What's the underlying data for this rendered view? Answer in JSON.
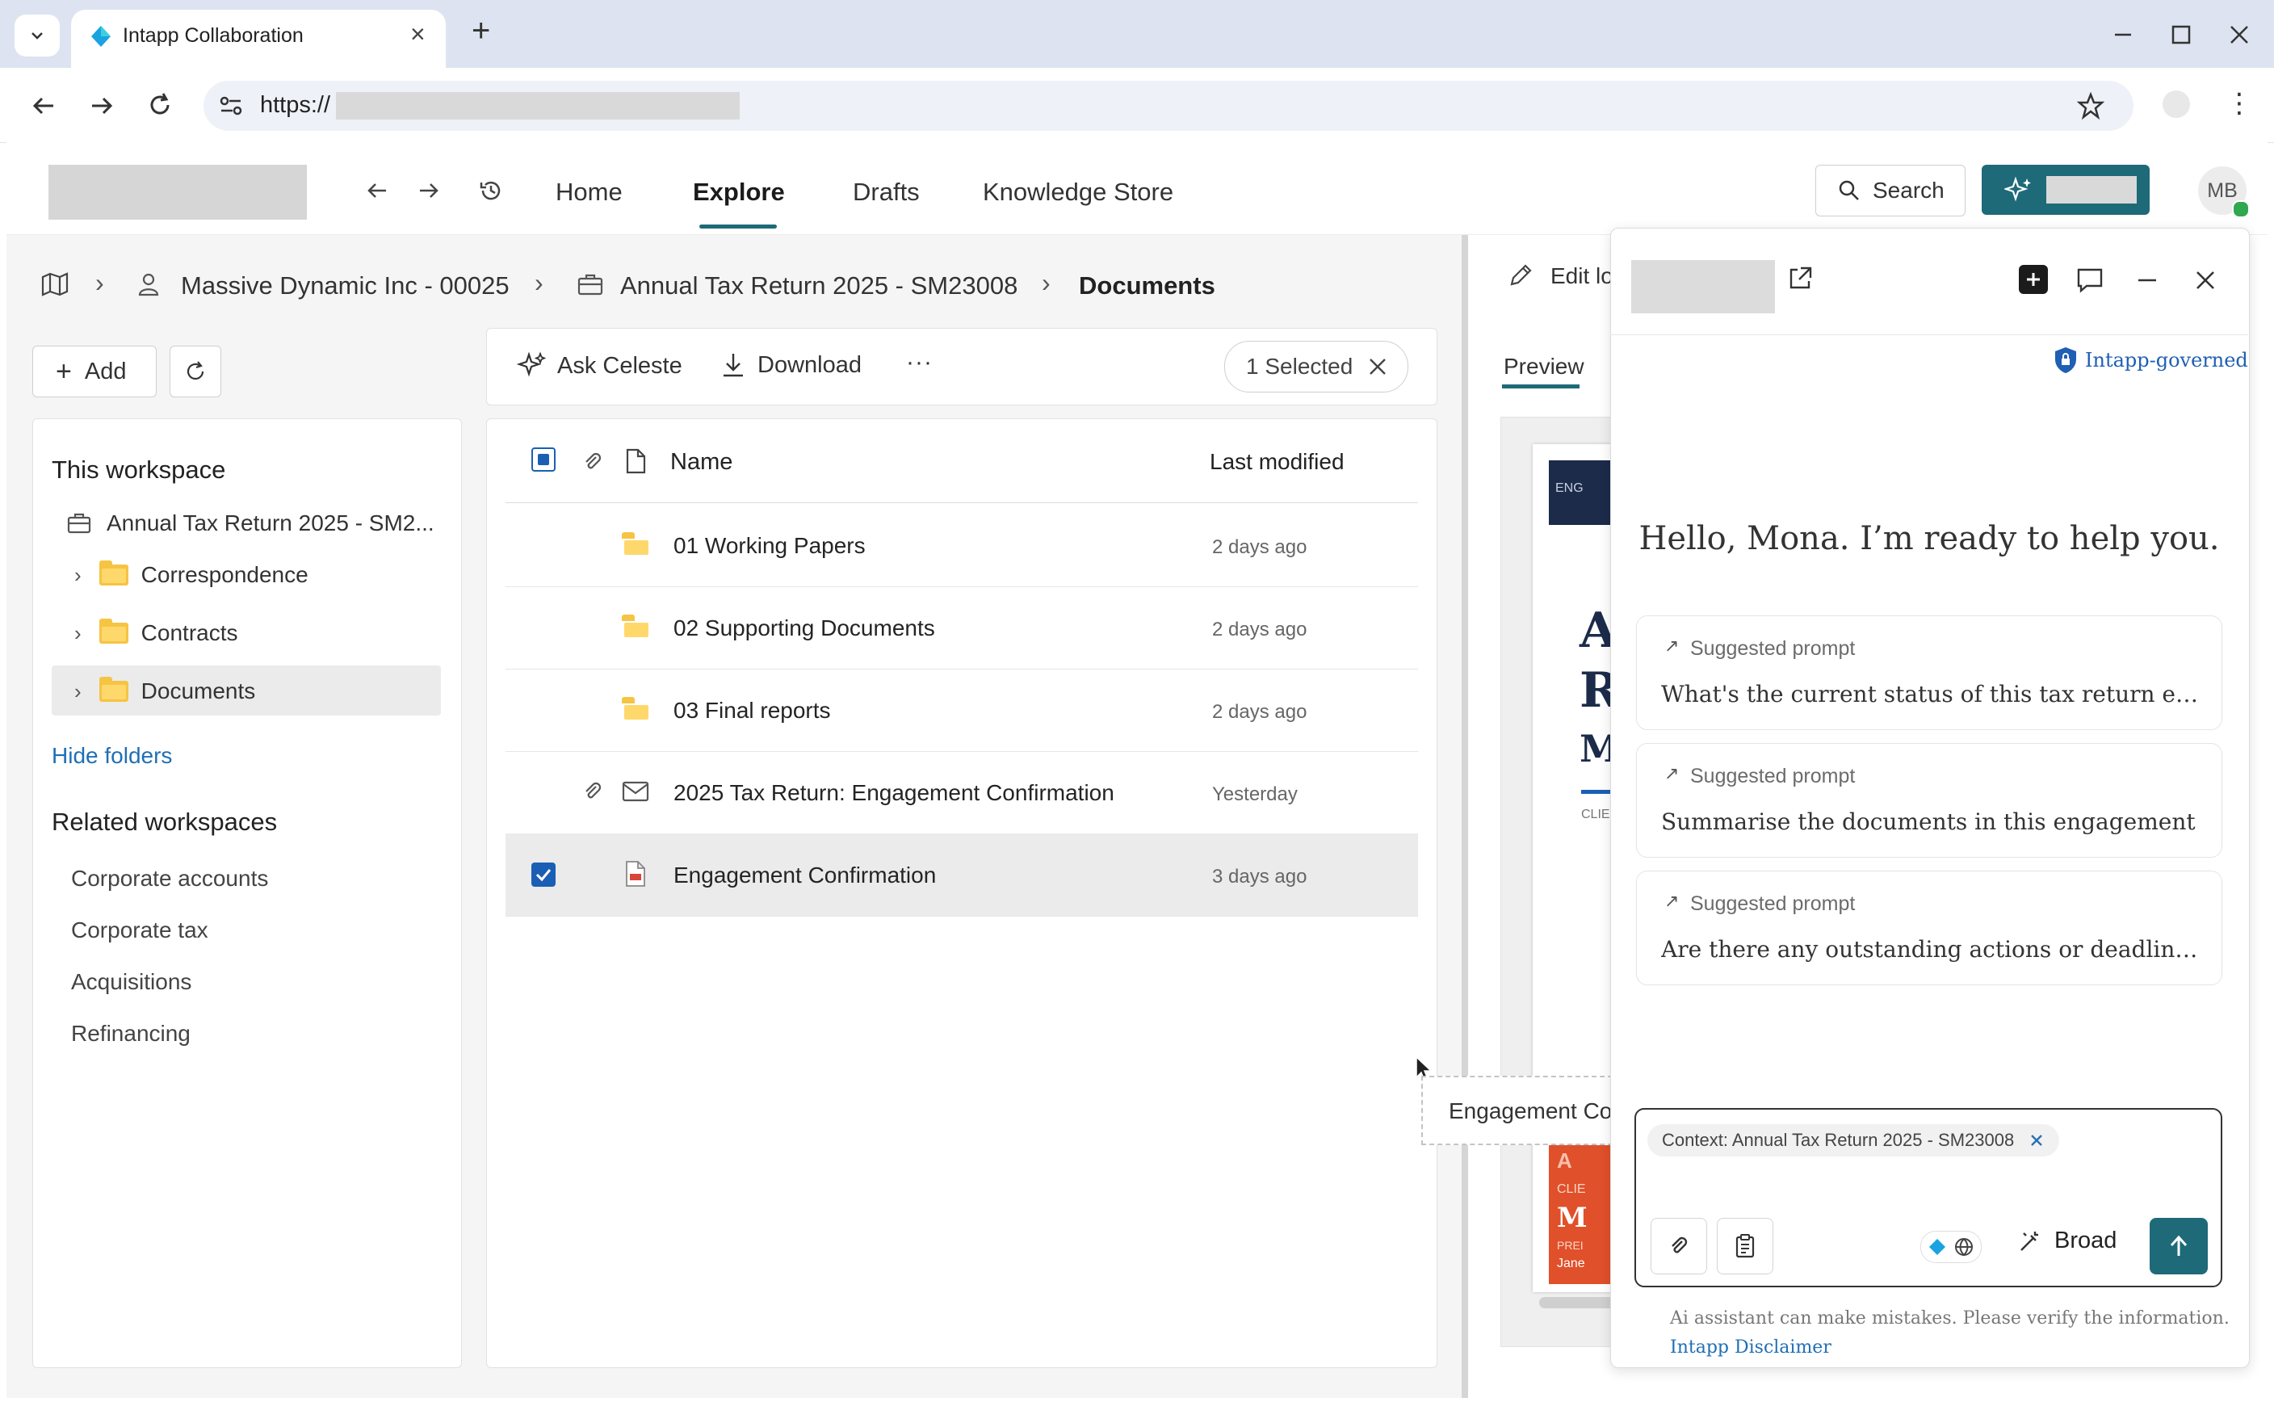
{
  "browser": {
    "tab_title": "Intapp Collaboration",
    "url_prefix": "https://"
  },
  "header": {
    "nav": [
      "Home",
      "Explore",
      "Drafts",
      "Knowledge Store"
    ],
    "active_nav": "Explore",
    "search_label": "Search",
    "avatar_initials": "MB"
  },
  "breadcrumb": {
    "client": "Massive Dynamic Inc - 00025",
    "engagement": "Annual Tax Return 2025 - SM23008",
    "current": "Documents"
  },
  "sidebar": {
    "add_label": "Add",
    "this_workspace_heading": "This workspace",
    "workspace_name": "Annual Tax Return 2025 - SM2...",
    "folders": [
      "Correspondence",
      "Contracts",
      "Documents"
    ],
    "selected_folder": "Documents",
    "hide_folders_label": "Hide folders",
    "related_heading": "Related workspaces",
    "related": [
      "Corporate accounts",
      "Corporate tax",
      "Acquisitions",
      "Refinancing"
    ]
  },
  "toolbar": {
    "ask_label": "Ask Celeste",
    "download_label": "Download",
    "more_label": "···",
    "selected_label": "1 Selected"
  },
  "table": {
    "col_name": "Name",
    "col_modified": "Last modified",
    "rows": [
      {
        "name": "01 Working Papers",
        "modified": "2 days ago",
        "type": "folder"
      },
      {
        "name": "02 Supporting Documents",
        "modified": "2 days ago",
        "type": "folder"
      },
      {
        "name": "03 Final reports",
        "modified": "2 days ago",
        "type": "folder"
      },
      {
        "name": "2025 Tax Return: Engagement Confirmation",
        "modified": "Yesterday",
        "type": "email"
      },
      {
        "name": "Engagement Confirmation",
        "modified": "3 days ago",
        "type": "pdf",
        "selected": true
      }
    ]
  },
  "drag_ghost": "Engagement Confirmation",
  "preview_pane": {
    "edit_label": "Edit lo",
    "tab_label": "Preview",
    "doc_letters": [
      "A",
      "R",
      "M"
    ],
    "doc_tag": "ENG",
    "doc_small": "CLIE",
    "doc_small2": "CLIE",
    "doc_letter2": "M",
    "doc_small3": "PREI",
    "doc_small4": "Jane",
    "doc_letter3": "A"
  },
  "assistant": {
    "governed_label": "Intapp-governed",
    "greeting": "Hello, Mona. I’m ready to help you.",
    "suggested_label": "Suggested prompt",
    "prompts": [
      "What's the current status of this tax return engagem...",
      "Summarise the documents in this engagement",
      "Are there any outstanding actions or deadlines?"
    ],
    "context_chip": "Context: Annual Tax Return 2025 - SM23008",
    "mode_label": "Broad",
    "disclaimer": "Ai assistant can make mistakes. Please verify the information.",
    "disclaimer_link": "Intapp Disclaimer"
  },
  "colors": {
    "accent_teal": "#1e6a78",
    "link_blue": "#1f6fb5",
    "folder_yellow": "#f6c443",
    "checkbox_blue": "#1a5fb4"
  }
}
